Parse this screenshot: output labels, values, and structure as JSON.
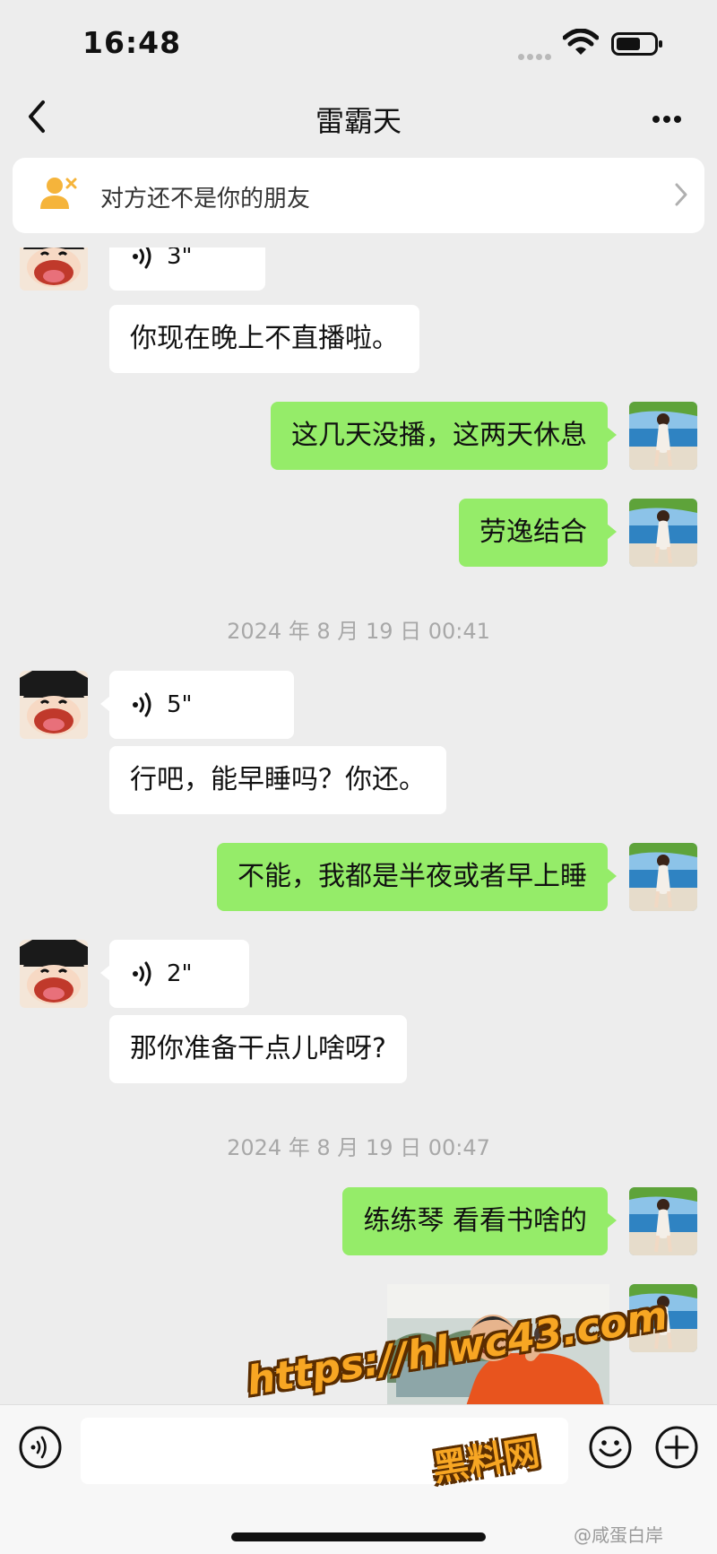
{
  "status_bar": {
    "time": "16:48"
  },
  "nav": {
    "title": "雷霸天"
  },
  "friend_banner": {
    "text": "对方还不是你的朋友"
  },
  "messages": [
    {
      "sender": "contact",
      "type": "voice",
      "duration": "3\""
    },
    {
      "sender": "contact",
      "type": "text",
      "text": "你现在晚上不直播啦。"
    },
    {
      "sender": "me",
      "type": "text",
      "text": "这几天没播，这两天休息"
    },
    {
      "sender": "me",
      "type": "text",
      "text": "劳逸结合"
    },
    {
      "type": "timestamp",
      "text": "2024 年 8 月 19 日 00:41"
    },
    {
      "sender": "contact",
      "type": "voice",
      "duration": "5\""
    },
    {
      "sender": "contact",
      "type": "text",
      "text": "行吧，能早睡吗？你还。"
    },
    {
      "sender": "me",
      "type": "text",
      "text": "不能，我都是半夜或者早上睡"
    },
    {
      "sender": "contact",
      "type": "voice",
      "duration": "2\""
    },
    {
      "sender": "contact",
      "type": "text",
      "text": "那你准备干点儿啥呀?"
    },
    {
      "type": "timestamp",
      "text": "2024 年 8 月 19 日 00:47"
    },
    {
      "sender": "me",
      "type": "text",
      "text": "练练琴 看看书啥的"
    },
    {
      "sender": "me",
      "type": "image"
    }
  ],
  "watermark": {
    "url": "https://hlwc43.com",
    "site": "黑料网",
    "weibo": "@咸蛋白岸"
  },
  "colors": {
    "background": "#ededed",
    "outgoing_bubble": "#95ec69",
    "incoming_bubble": "#ffffff",
    "timestamp_text": "#a8a8a8",
    "watermark": "#f7a623"
  }
}
